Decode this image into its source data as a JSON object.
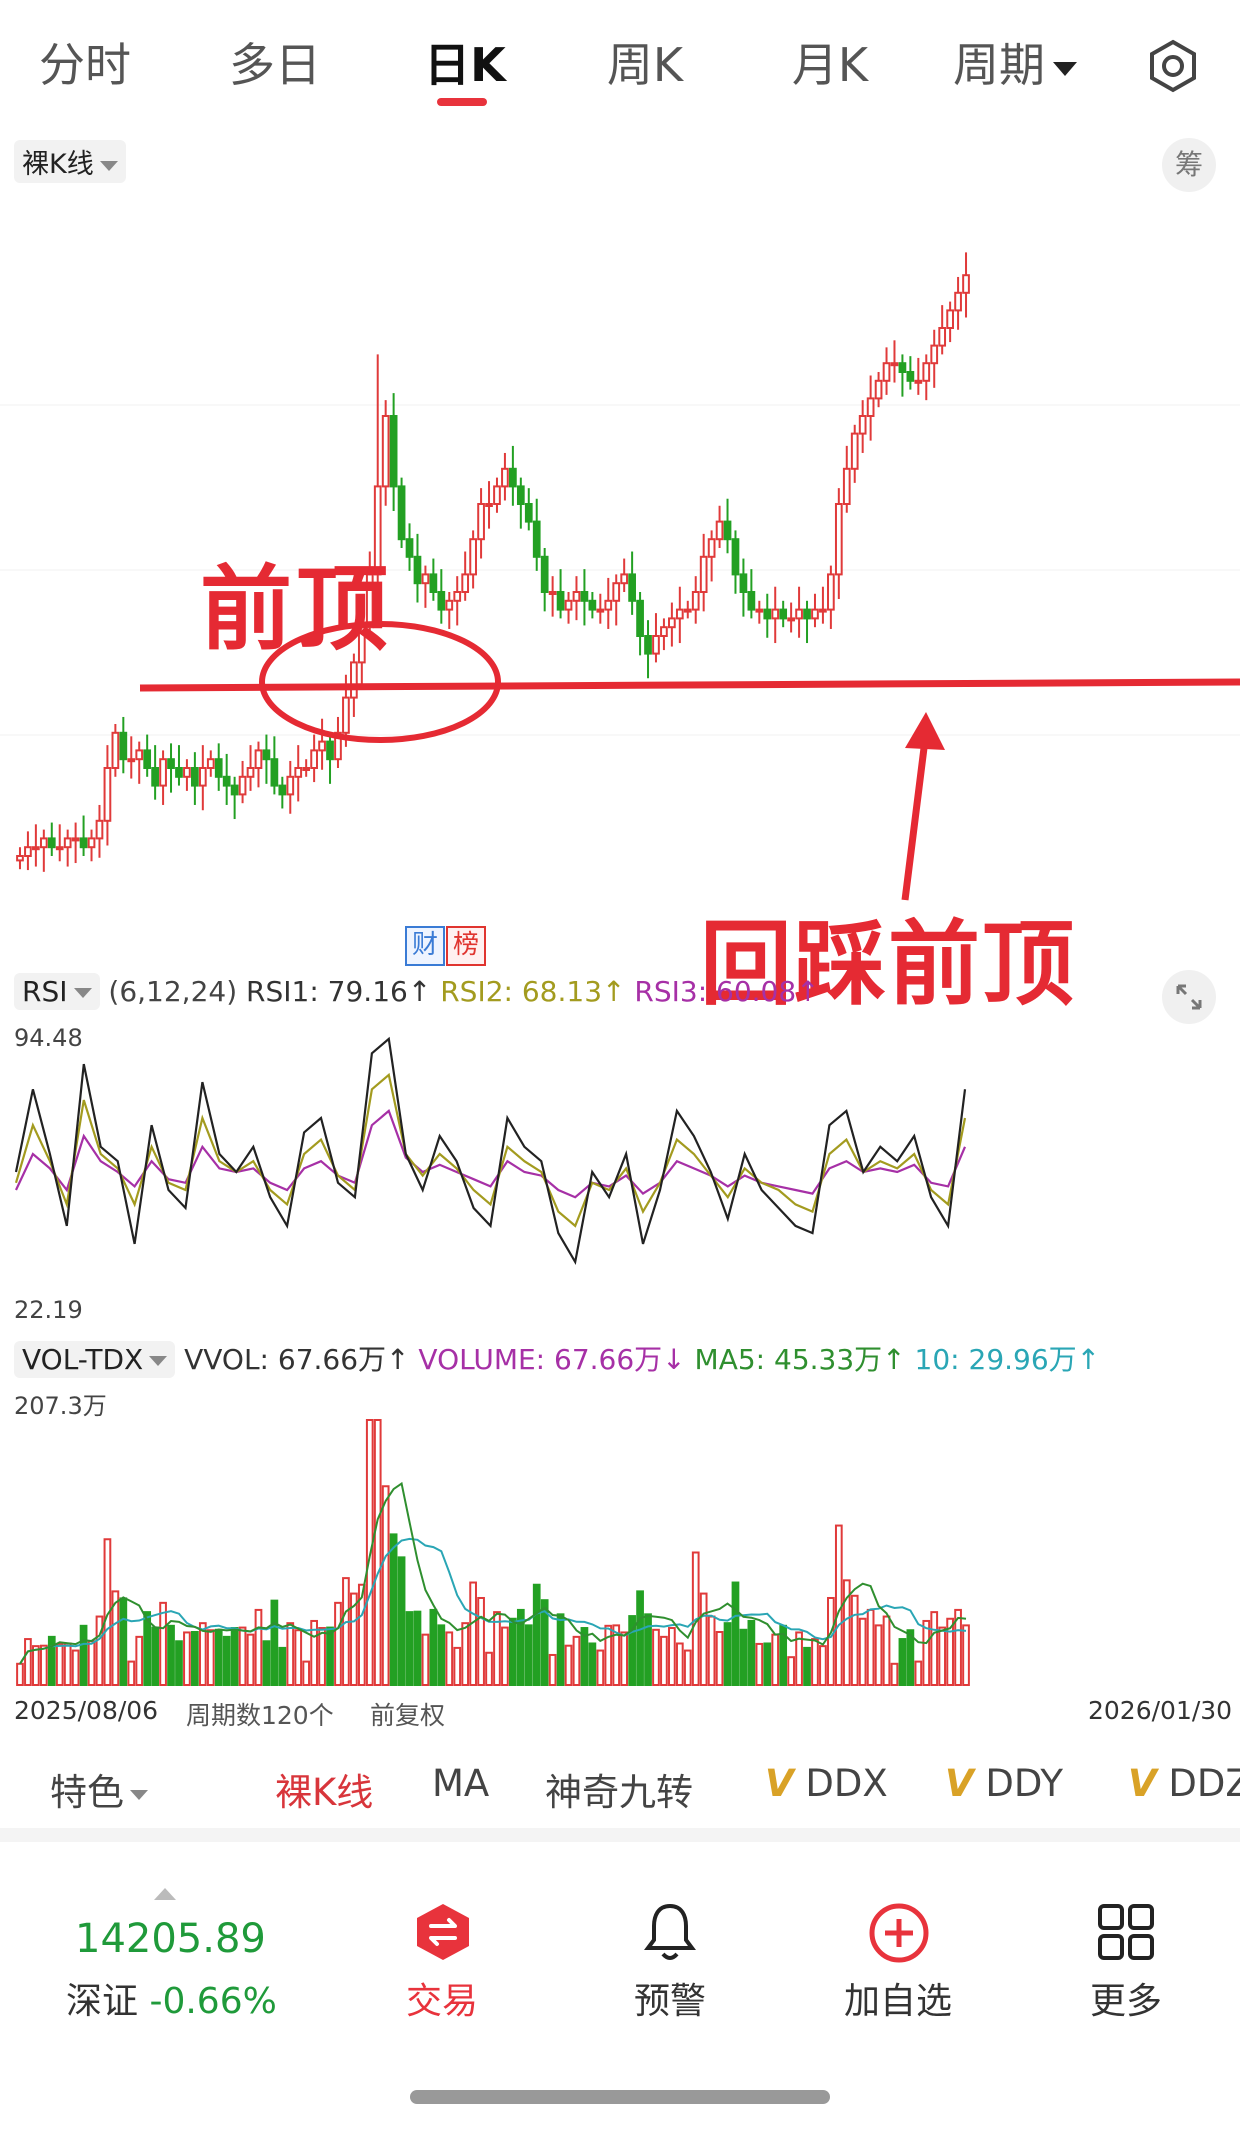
{
  "tabs": [
    {
      "label": "分时",
      "active": false
    },
    {
      "label": "多日",
      "active": false
    },
    {
      "label": "日K",
      "active": true
    },
    {
      "label": "周K",
      "active": false
    },
    {
      "label": "月K",
      "active": false
    },
    {
      "label": "周期",
      "active": false
    }
  ],
  "chart_selector": "裸K线",
  "chip_button": "筹",
  "annotations": {
    "prev_top": "前顶",
    "retest": "回踩前顶",
    "badge1": "财",
    "badge2": "榜"
  },
  "rsi": {
    "name": "RSI",
    "params": "(6,12,24)",
    "rsi1": "RSI1: 79.16↑",
    "rsi2": "RSI2: 68.13↑",
    "rsi3": "RSI3: 60.08↑",
    "max": "94.48",
    "min": "22.19",
    "colors": {
      "rsi1": "#222222",
      "rsi2": "#a39b1f",
      "rsi3": "#a630a6"
    }
  },
  "vol": {
    "name": "VOL-TDX",
    "vvol": "VVOL: 67.66万↑",
    "volume": "VOLUME: 67.66万↓",
    "ma5": "MA5: 45.33万↑",
    "ma10": "10: 29.96万↑",
    "max": "207.3万",
    "colors": {
      "ma5": "#2f8f2f",
      "ma10": "#2aa6b5"
    }
  },
  "footer": {
    "start_date": "2025/08/06",
    "periods": "周期数120个",
    "adjust": "前复权",
    "end_date": "2026/01/30"
  },
  "features": {
    "label": "特色",
    "items": [
      "裸K线",
      "MA",
      "神奇九转",
      "DDX",
      "DDY",
      "DDZ"
    ]
  },
  "bottom_bar": {
    "index_value": "14205.89",
    "index_name": "深证",
    "index_change": "-0.66%",
    "trade": "交易",
    "alert": "预警",
    "add_watch": "加自选",
    "more": "更多"
  },
  "colors": {
    "up": "#e03a3a",
    "down": "#23a023",
    "accent": "#e8333c",
    "annotation": "#e52a33"
  },
  "chart_data": {
    "type": "candlestick",
    "price_closes": [
      30,
      31,
      31,
      32,
      31,
      31,
      32,
      32,
      31,
      32,
      34,
      40,
      44,
      41,
      41,
      42,
      40,
      38,
      41,
      40,
      39,
      40,
      38,
      40,
      41,
      39,
      38,
      37,
      39,
      40,
      42,
      41,
      38,
      37,
      39,
      40,
      40,
      42,
      43,
      41,
      44,
      48,
      52,
      56,
      62,
      72,
      80,
      72,
      66,
      64,
      61,
      62,
      60,
      58,
      59,
      60,
      62,
      66,
      70,
      70,
      72,
      74,
      72,
      70,
      68,
      64,
      60,
      60,
      58,
      59,
      60,
      59,
      58,
      58,
      59,
      61,
      62,
      59,
      55,
      53,
      55,
      56,
      57,
      58,
      58,
      60,
      64,
      66,
      68,
      66,
      62,
      60,
      58,
      58,
      57,
      58,
      57,
      57,
      58,
      57,
      58,
      58,
      62,
      70,
      74,
      78,
      80,
      82,
      84,
      86,
      86,
      85,
      84,
      84,
      86,
      88,
      90,
      92,
      94,
      96
    ],
    "rsi1": [
      55,
      78,
      60,
      40,
      85,
      62,
      58,
      35,
      68,
      50,
      45,
      80,
      60,
      55,
      62,
      48,
      40,
      66,
      70,
      52,
      48,
      88,
      92,
      60,
      50,
      65,
      58,
      45,
      40,
      70,
      62,
      58,
      38,
      30,
      55,
      48,
      60,
      35,
      50,
      72,
      65,
      55,
      42,
      60,
      50,
      45,
      40,
      38,
      68,
      72,
      55,
      62,
      58,
      65,
      48,
      40,
      78
    ],
    "rsi2": [
      52,
      68,
      58,
      46,
      75,
      60,
      56,
      46,
      62,
      52,
      50,
      70,
      58,
      55,
      58,
      50,
      46,
      60,
      64,
      54,
      50,
      78,
      82,
      60,
      54,
      60,
      56,
      50,
      46,
      62,
      58,
      55,
      44,
      40,
      52,
      50,
      56,
      44,
      52,
      64,
      60,
      54,
      48,
      56,
      52,
      50,
      46,
      44,
      60,
      64,
      55,
      58,
      56,
      60,
      50,
      46,
      70
    ],
    "rsi3": [
      50,
      60,
      56,
      50,
      65,
      58,
      55,
      51,
      58,
      53,
      52,
      62,
      56,
      55,
      56,
      52,
      50,
      56,
      58,
      54,
      52,
      68,
      72,
      59,
      55,
      57,
      55,
      53,
      51,
      58,
      55,
      54,
      50,
      48,
      52,
      51,
      54,
      49,
      52,
      58,
      56,
      54,
      51,
      54,
      52,
      51,
      50,
      49,
      56,
      58,
      55,
      56,
      55,
      57,
      52,
      51,
      62
    ],
    "volume_max": "207.3万"
  }
}
